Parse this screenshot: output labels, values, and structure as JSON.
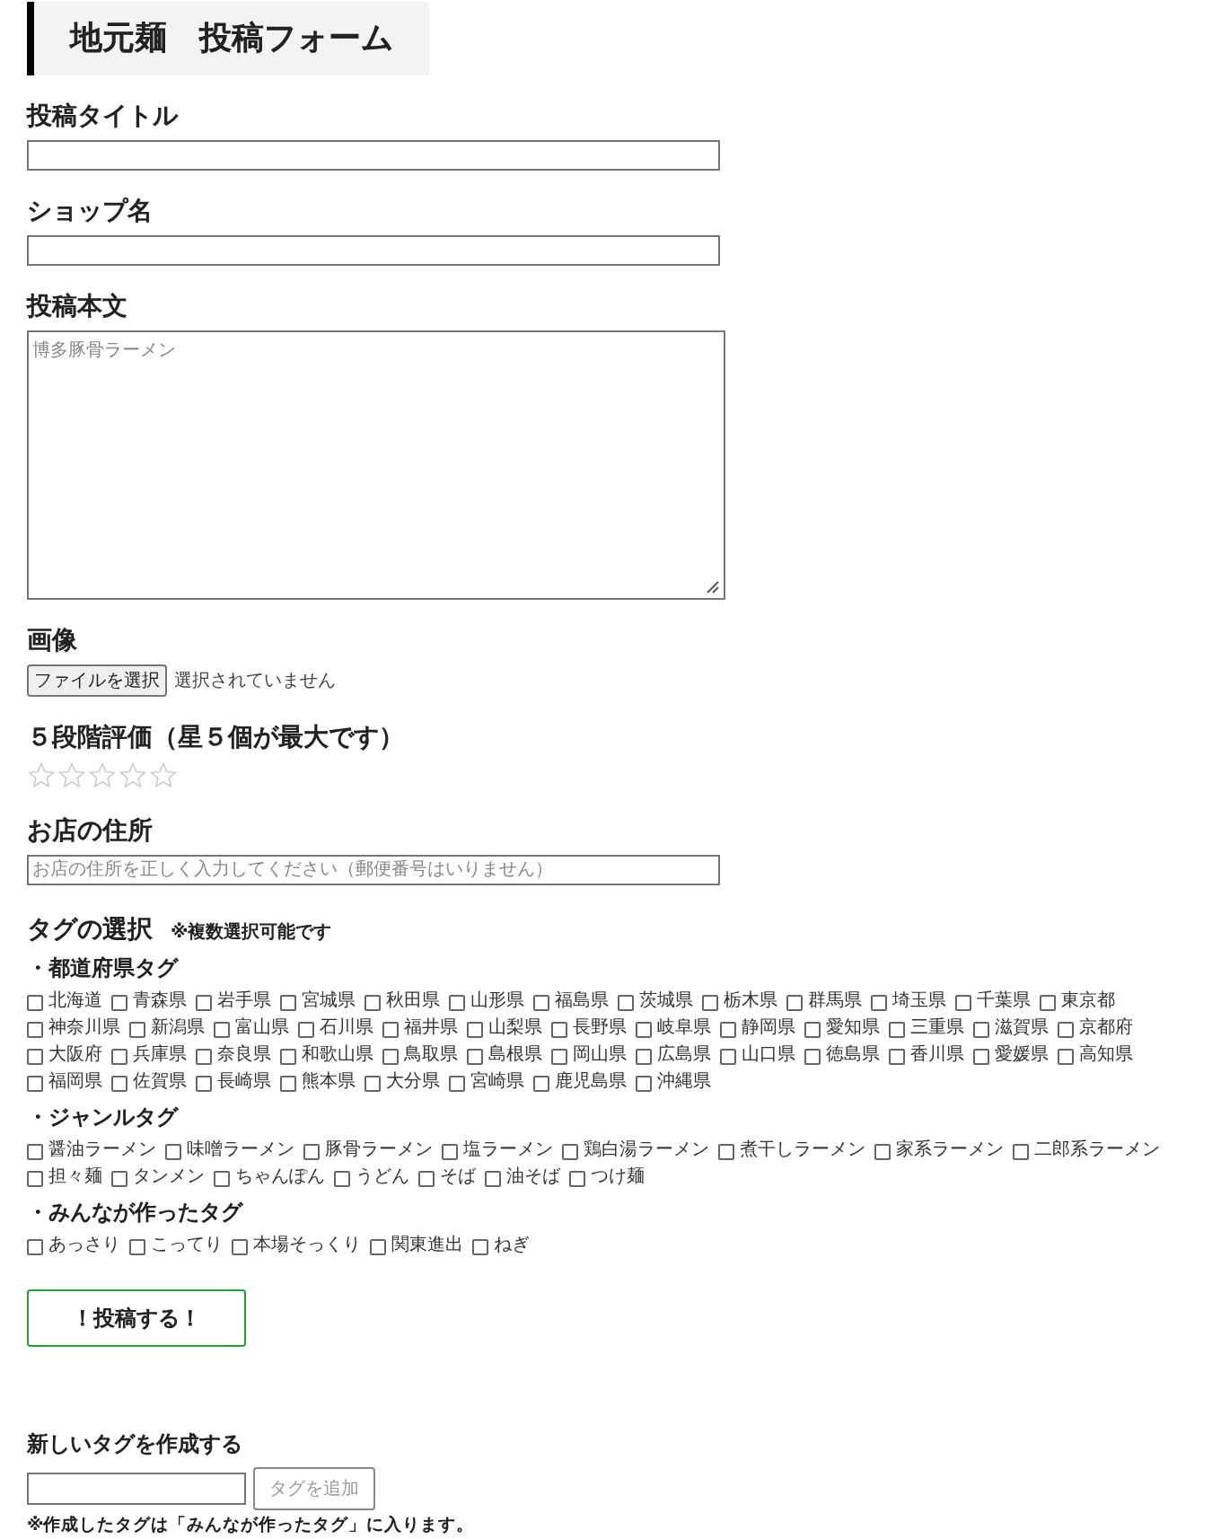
{
  "page_title": "地元麺　投稿フォーム",
  "fields": [
    {
      "kind": "text",
      "label": "投稿タイトル"
    },
    {
      "kind": "text",
      "label": "ショップ名"
    },
    {
      "kind": "textarea",
      "label": "投稿本文",
      "placeholder": "博多豚骨ラーメン"
    },
    {
      "kind": "file",
      "label": "画像",
      "button": "ファイルを選択",
      "status": "選択されていません"
    },
    {
      "kind": "rating",
      "label": "５段階評価（星５個が最大です）",
      "stars": 0
    },
    {
      "kind": "text",
      "label": "お店の住所",
      "placeholder": "お店の住所を正しく入力してください（郵便番号はいりません）"
    }
  ],
  "tags": {
    "heading": "タグの選択",
    "note": "※複数選択可能です",
    "groups": [
      {
        "title": "・都道府県タグ",
        "items": [
          {
            "label": "北海道",
            "checked": false
          },
          {
            "label": "青森県",
            "checked": false
          },
          {
            "label": "岩手県",
            "checked": false
          },
          {
            "label": "宮城県",
            "checked": false
          },
          {
            "label": "秋田県",
            "checked": false
          },
          {
            "label": "山形県",
            "checked": false
          },
          {
            "label": "福島県",
            "checked": false
          },
          {
            "label": "茨城県",
            "checked": false
          },
          {
            "label": "栃木県",
            "checked": false
          },
          {
            "label": "群馬県",
            "checked": false
          },
          {
            "label": "埼玉県",
            "checked": false
          },
          {
            "label": "千葉県",
            "checked": false
          },
          {
            "label": "東京都",
            "checked": false
          },
          {
            "label": "神奈川県",
            "checked": false
          },
          {
            "label": "新潟県",
            "checked": false
          },
          {
            "label": "富山県",
            "checked": false
          },
          {
            "label": "石川県",
            "checked": false
          },
          {
            "label": "福井県",
            "checked": false
          },
          {
            "label": "山梨県",
            "checked": false
          },
          {
            "label": "長野県",
            "checked": false
          },
          {
            "label": "岐阜県",
            "checked": false
          },
          {
            "label": "静岡県",
            "checked": false
          },
          {
            "label": "愛知県",
            "checked": false
          },
          {
            "label": "三重県",
            "checked": false
          },
          {
            "label": "滋賀県",
            "checked": false
          },
          {
            "label": "京都府",
            "checked": false
          },
          {
            "label": "大阪府",
            "checked": false
          },
          {
            "label": "兵庫県",
            "checked": false
          },
          {
            "label": "奈良県",
            "checked": false
          },
          {
            "label": "和歌山県",
            "checked": false
          },
          {
            "label": "鳥取県",
            "checked": false
          },
          {
            "label": "島根県",
            "checked": false
          },
          {
            "label": "岡山県",
            "checked": false
          },
          {
            "label": "広島県",
            "checked": false
          },
          {
            "label": "山口県",
            "checked": false
          },
          {
            "label": "徳島県",
            "checked": false
          },
          {
            "label": "香川県",
            "checked": false
          },
          {
            "label": "愛媛県",
            "checked": false
          },
          {
            "label": "高知県",
            "checked": false
          },
          {
            "label": "福岡県",
            "checked": false
          },
          {
            "label": "佐賀県",
            "checked": false
          },
          {
            "label": "長崎県",
            "checked": false
          },
          {
            "label": "熊本県",
            "checked": false
          },
          {
            "label": "大分県",
            "checked": false
          },
          {
            "label": "宮崎県",
            "checked": false
          },
          {
            "label": "鹿児島県",
            "checked": false
          },
          {
            "label": "沖縄県",
            "checked": false
          }
        ]
      },
      {
        "title": "・ジャンルタグ",
        "items": [
          {
            "label": "醤油ラーメン",
            "checked": false
          },
          {
            "label": "味噌ラーメン",
            "checked": false
          },
          {
            "label": "豚骨ラーメン",
            "checked": false
          },
          {
            "label": "塩ラーメン",
            "checked": false
          },
          {
            "label": "鶏白湯ラーメン",
            "checked": false
          },
          {
            "label": "煮干しラーメン",
            "checked": false
          },
          {
            "label": "家系ラーメン",
            "checked": false
          },
          {
            "label": "二郎系ラーメン",
            "checked": false
          },
          {
            "label": "担々麺",
            "checked": false
          },
          {
            "label": "タンメン",
            "checked": false
          },
          {
            "label": "ちゃんぽん",
            "checked": false
          },
          {
            "label": "うどん",
            "checked": false
          },
          {
            "label": "そば",
            "checked": false
          },
          {
            "label": "油そば",
            "checked": false
          },
          {
            "label": "つけ麺",
            "checked": false
          }
        ]
      },
      {
        "title": "・みんなが作ったタグ",
        "items": [
          {
            "label": "あっさり",
            "checked": false
          },
          {
            "label": "こってり",
            "checked": false
          },
          {
            "label": "本場そっくり",
            "checked": false
          },
          {
            "label": "関東進出",
            "checked": false
          },
          {
            "label": "ねぎ",
            "checked": false
          }
        ]
      }
    ]
  },
  "submit": "！投稿する！",
  "new_tag": {
    "heading": "新しいタグを作成する",
    "button": "タグを追加",
    "disabled": true,
    "note": "※作成したタグは「みんなが作ったタグ」に入ります。"
  }
}
